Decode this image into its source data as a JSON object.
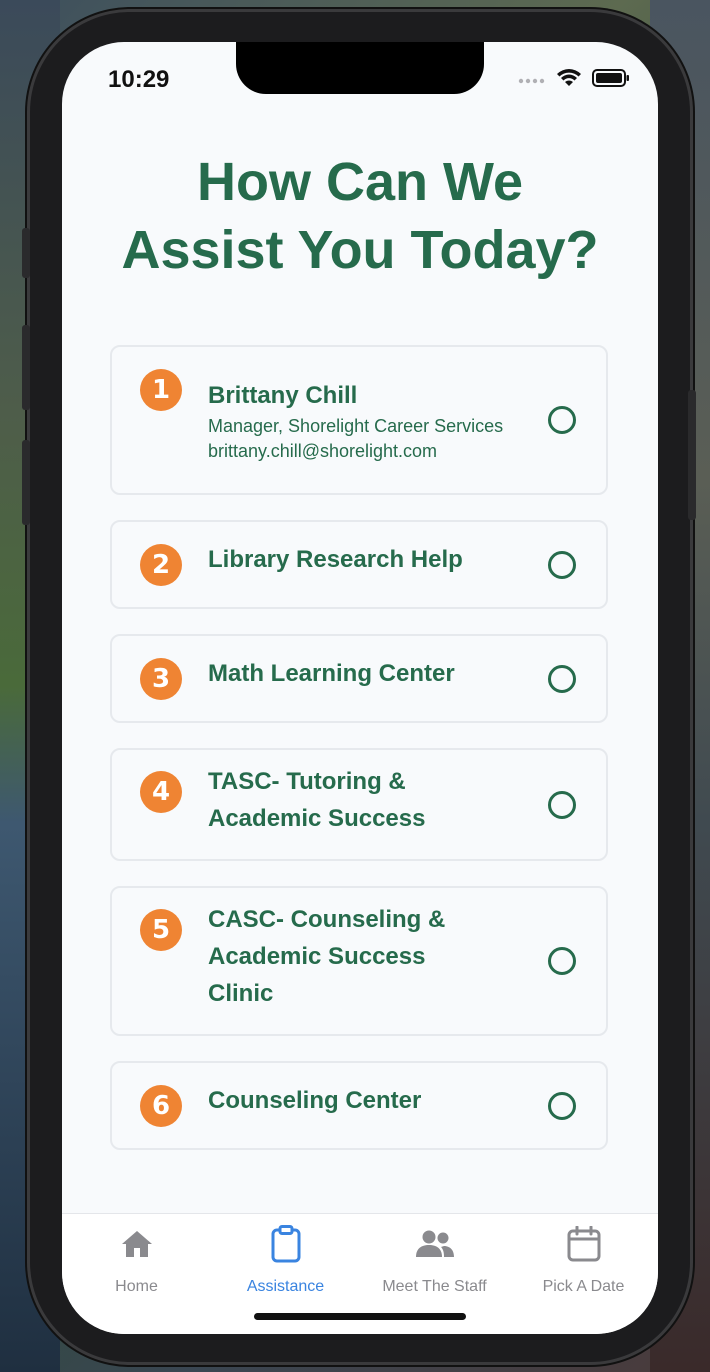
{
  "status_bar": {
    "time": "10:29"
  },
  "page": {
    "title_line1": "How Can We",
    "title_line2": "Assist You Today?"
  },
  "options": [
    {
      "number": "1",
      "name": "Brittany Chill",
      "subtitle": "Manager, Shorelight Career Services",
      "email": "brittany.chill@shorelight.com",
      "selected": false
    },
    {
      "number": "2",
      "name": "Library Research Help",
      "selected": false
    },
    {
      "number": "3",
      "name": "Math Learning Center",
      "selected": false
    },
    {
      "number": "4",
      "name": "TASC- Tutoring & Academic Success",
      "selected": false
    },
    {
      "number": "5",
      "name": "CASC- Counseling & Academic Success Clinic",
      "selected": false
    },
    {
      "number": "6",
      "name": "Counseling Center",
      "selected": false
    }
  ],
  "tabbar": {
    "tabs": [
      {
        "label": "Home",
        "icon": "home-icon",
        "active": false
      },
      {
        "label": "Assistance",
        "icon": "clipboard-icon",
        "active": true
      },
      {
        "label": "Meet The Staff",
        "icon": "people-icon",
        "active": false
      },
      {
        "label": "Pick A Date",
        "icon": "calendar-icon",
        "active": false
      }
    ]
  },
  "colors": {
    "primary_green": "#266b4c",
    "accent_orange": "#ef8433",
    "active_blue": "#3a84e0",
    "inactive_gray": "#8a8a8e"
  }
}
